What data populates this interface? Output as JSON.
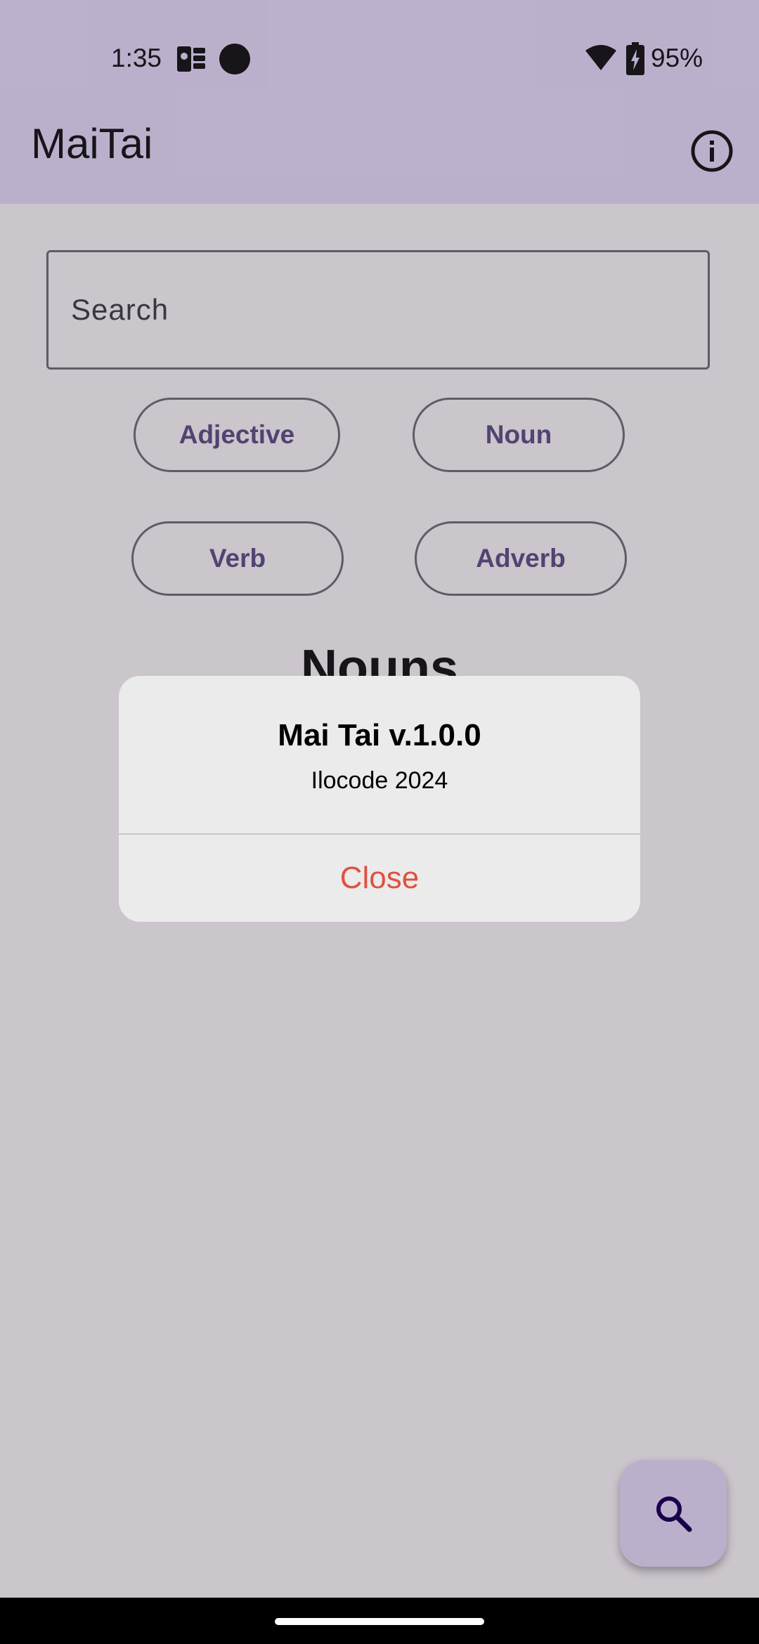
{
  "status_bar": {
    "time": "1:35",
    "battery": "95%",
    "icons": [
      "photo-icon",
      "circle-icon",
      "wifi-icon",
      "battery-charging-icon"
    ]
  },
  "app_bar": {
    "title": "MaiTai",
    "action_icon": "info-icon"
  },
  "search": {
    "placeholder": "Search"
  },
  "chips": {
    "adjective": "Adjective",
    "noun": "Noun",
    "verb": "Verb",
    "adverb": "Adverb"
  },
  "section": {
    "heading": "Nouns"
  },
  "dialog": {
    "title": "Mai Tai v.1.0.0",
    "message": "Ilocode 2024",
    "close_label": "Close"
  },
  "fab": {
    "icon": "search-icon"
  },
  "colors": {
    "app_bar": "#EADDFF",
    "chip_text": "#65558F",
    "close_text": "#E0513F",
    "dialog_bg": "#EBEBEB"
  }
}
